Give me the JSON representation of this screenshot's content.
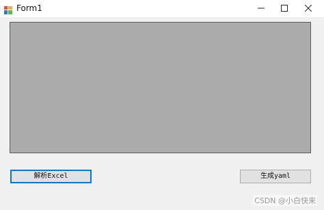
{
  "window": {
    "title": "Form1",
    "controls": {
      "minimize": "minimize",
      "maximize": "maximize",
      "close": "close"
    }
  },
  "main": {
    "grid": {
      "color": "#ababab"
    },
    "buttons": {
      "parse_excel": "解析Excel",
      "generate_yaml": "生成yaml"
    }
  },
  "watermark": {
    "text": "CSDN @小白快来"
  },
  "colors": {
    "focus_border": "#0078d7",
    "window_bg": "#f0f0f0"
  }
}
